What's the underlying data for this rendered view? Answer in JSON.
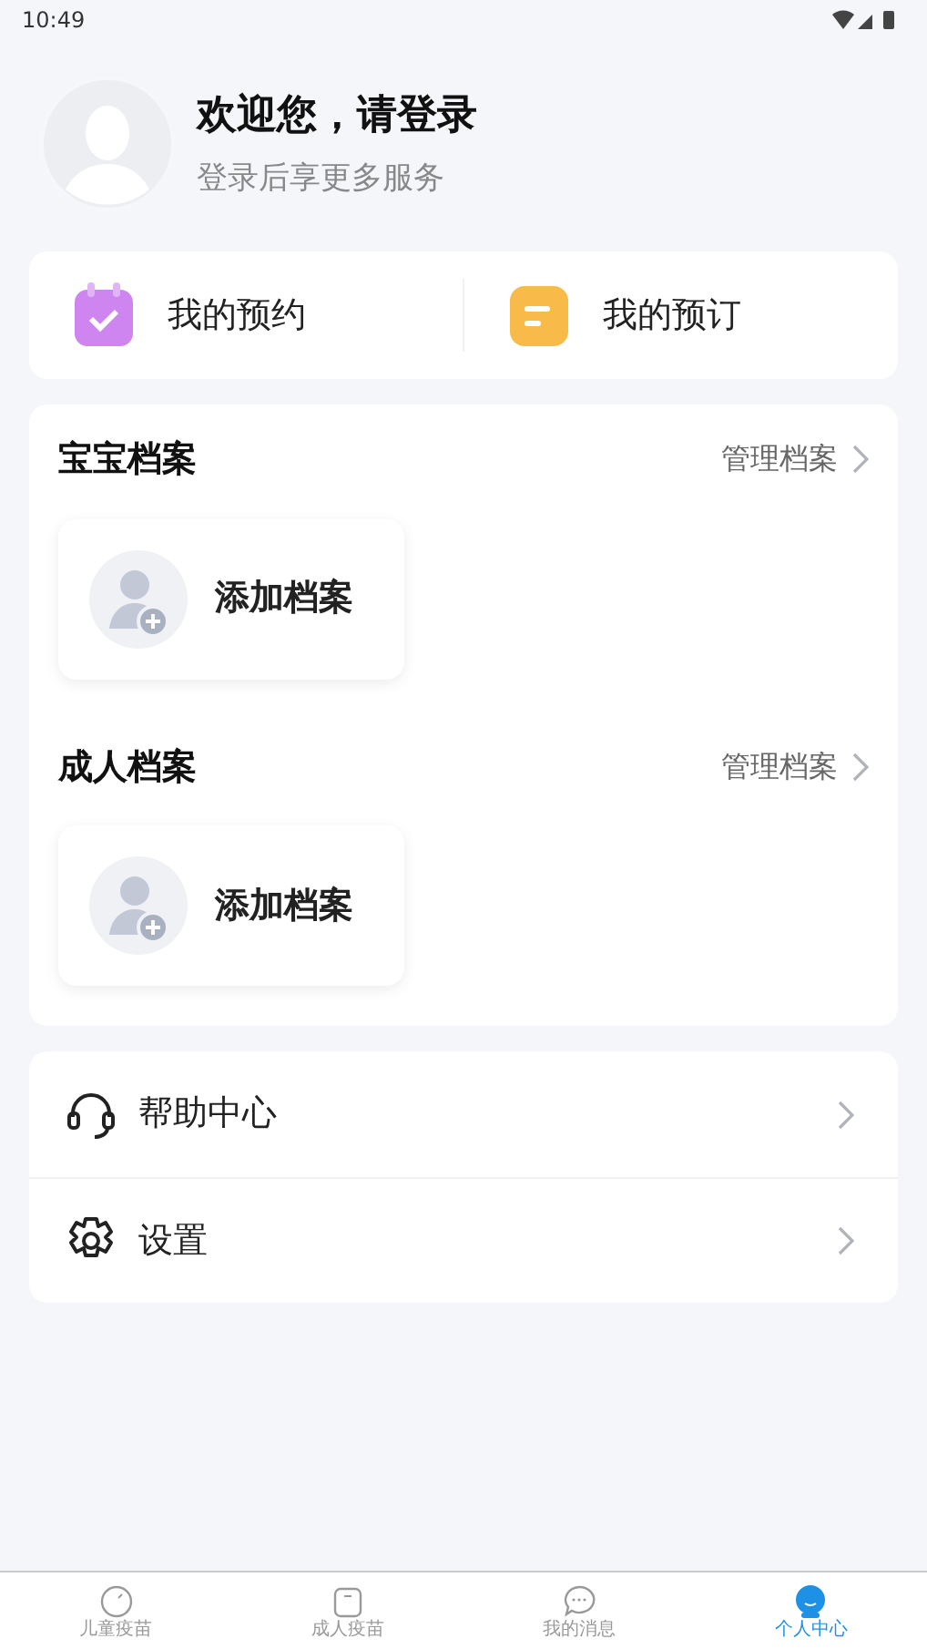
{
  "status_bar": {
    "time": "10:49"
  },
  "profile": {
    "title": "欢迎您，请登录",
    "subtitle": "登录后享更多服务"
  },
  "shortcuts": [
    {
      "kind": "appointment",
      "label": "我的预约"
    },
    {
      "kind": "order",
      "label": "我的预订"
    }
  ],
  "archives": [
    {
      "title": "宝宝档案",
      "manage": "管理档案",
      "add": "添加档案"
    },
    {
      "title": "成人档案",
      "manage": "管理档案",
      "add": "添加档案"
    }
  ],
  "menu": [
    {
      "kind": "help",
      "label": "帮助中心"
    },
    {
      "kind": "settings",
      "label": "设置"
    }
  ],
  "tab_bar": [
    {
      "kind": "child",
      "label": "儿童疫苗",
      "selected": false
    },
    {
      "kind": "adult",
      "label": "成人疫苗",
      "selected": false
    },
    {
      "kind": "message",
      "label": "我的消息",
      "selected": false
    },
    {
      "kind": "me",
      "label": "个人中心",
      "selected": true
    }
  ]
}
